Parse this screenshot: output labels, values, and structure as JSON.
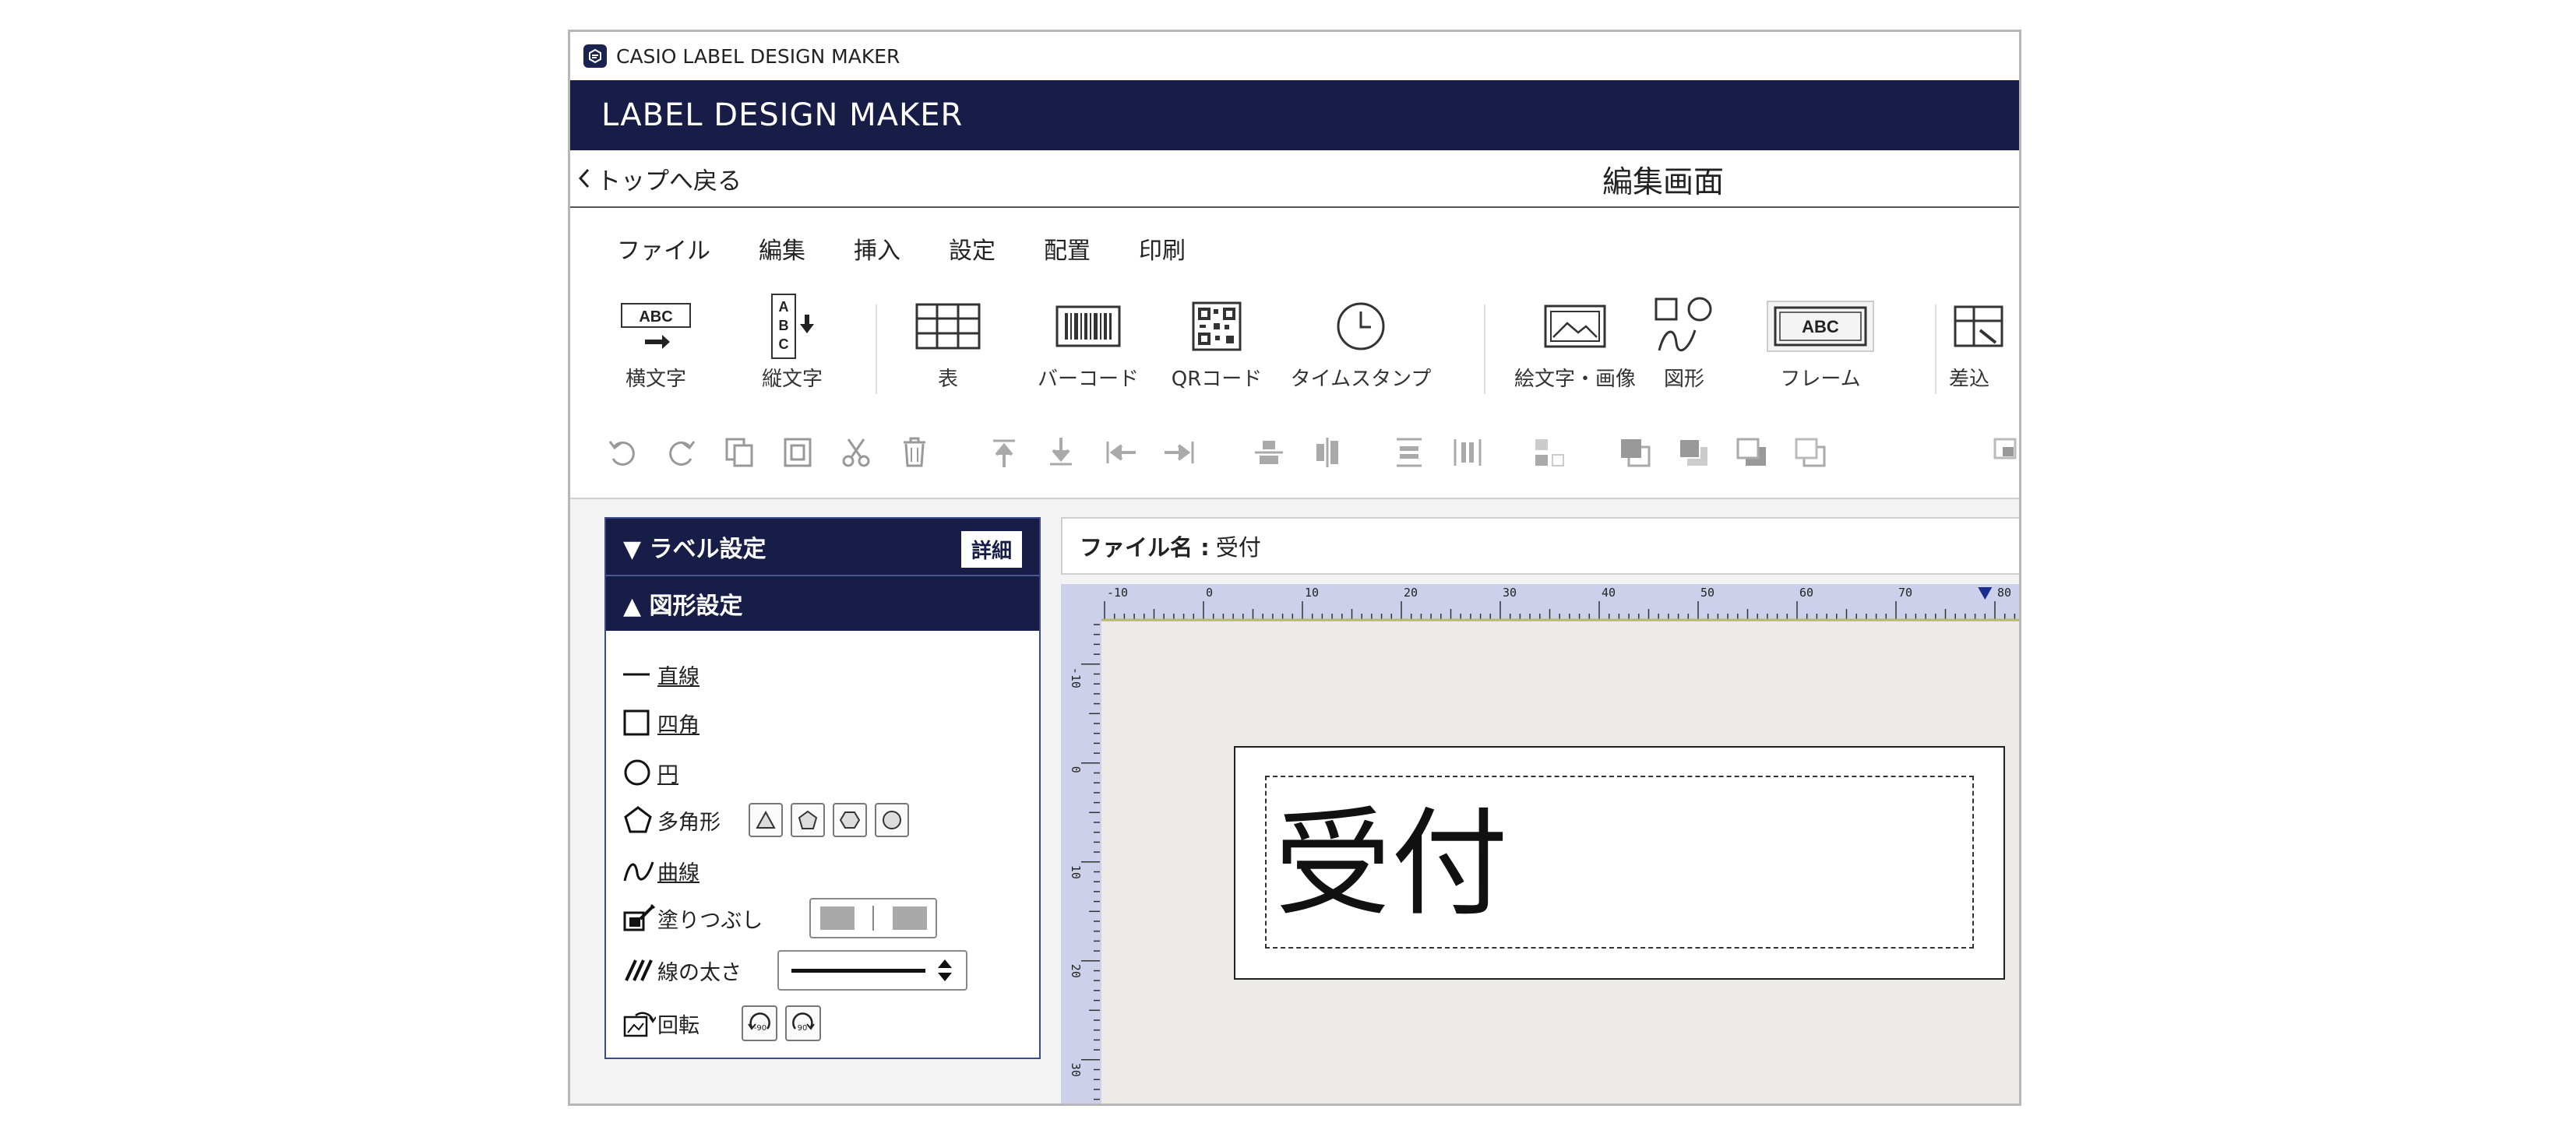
{
  "titlebar": {
    "text": "CASIO LABEL DESIGN MAKER",
    "icon": "app-logo-icon"
  },
  "brandbar": {
    "text": "LABEL DESIGN MAKER"
  },
  "navbar": {
    "back_label": "トップへ戻る",
    "screen_title": "編集画面"
  },
  "menu": [
    "ファイル",
    "編集",
    "挿入",
    "設定",
    "配置",
    "印刷"
  ],
  "tools": [
    {
      "label": "横文字",
      "icon": "horizontal-text-icon"
    },
    {
      "label": "縦文字",
      "icon": "vertical-text-icon"
    },
    {
      "label": "表",
      "icon": "table-icon"
    },
    {
      "label": "バーコード",
      "icon": "barcode-icon"
    },
    {
      "label": "QRコード",
      "icon": "qr-code-icon"
    },
    {
      "label": "タイムスタンプ",
      "icon": "clock-icon"
    },
    {
      "label": "絵文字・画像",
      "icon": "image-icon"
    },
    {
      "label": "図形",
      "icon": "shapes-icon"
    },
    {
      "label": "フレーム",
      "icon": "frame-icon"
    },
    {
      "label": "差込",
      "icon": "insert-data-icon"
    }
  ],
  "panel": {
    "label_settings": "▼ ラベル設定",
    "detail_button": "詳細",
    "shape_settings": "▲ 図形設定",
    "shapes": {
      "line": "直線",
      "rect": "四角",
      "circle": "円",
      "polygon": "多角形",
      "curve": "曲線",
      "fill": "塗りつぶし",
      "line_width": "線の太さ",
      "rotate": "回転"
    }
  },
  "canvas": {
    "filename_label": "ファイル名 :",
    "filename_value": "受付",
    "label_text": "受付",
    "ruler_h": [
      "-10",
      "0",
      "10",
      "20",
      "30",
      "40",
      "50",
      "60",
      "70",
      "80"
    ],
    "ruler_v": [
      "-10",
      "0",
      "10",
      "20",
      "30"
    ]
  },
  "colors": {
    "brand": "#171d46",
    "ruler": "#cdd0ea",
    "stage": "#ecebe7"
  }
}
